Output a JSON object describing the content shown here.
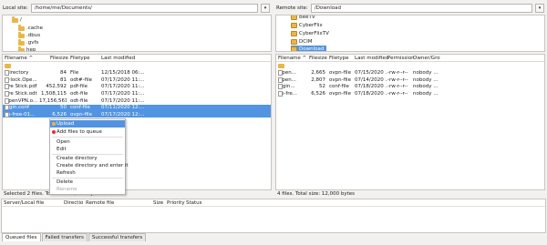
{
  "local": {
    "site_label": "Local site:",
    "path": "/home/me/Documents/",
    "tree": [
      ".cache",
      ".dbus",
      ".gvfs",
      "hep"
    ],
    "tree_root": "/",
    "columns": [
      "Filename ^",
      "Filesize",
      "Filetype",
      "Last modified"
    ],
    "files": [
      {
        "name": "..",
        "size": "",
        "type": "",
        "modified": "",
        "selected": false
      },
      {
        "name": ".directory",
        "size": "84",
        "type": "File",
        "modified": "12/15/2018 06:...",
        "selected": false
      },
      {
        "name": ".~lock.Ope...",
        "size": "81",
        "type": "odt#-file",
        "modified": "07/17/2020 11:...",
        "selected": false
      },
      {
        "name": "Fire Stick.pdf",
        "size": "452,592",
        "type": "pdf-file",
        "modified": "07/17/2020 11:...",
        "selected": false
      },
      {
        "name": "Fire Stick.odt",
        "size": "1,508,115",
        "type": "odt-file",
        "modified": "07/17/2020 11:...",
        "selected": false
      },
      {
        "name": "OpenVPN.o...",
        "size": "17,156,561",
        "type": "odt-file",
        "modified": "07/17/2020 11:...",
        "selected": false
      },
      {
        "name": "login.conf",
        "size": "50",
        "type": "conf-file",
        "modified": "07/11/2020 12:...",
        "selected": true
      },
      {
        "name": "us-free-01...",
        "size": "6,526",
        "type": "ovpn-file",
        "modified": "07/17/2020 12:...",
        "selected": true
      }
    ],
    "status": "Selected 2 files. Total size: 6,576 bytes"
  },
  "remote": {
    "site_label": "Remote site:",
    "path": "/Download",
    "tree": [
      "BeeTV",
      "CyberFlix",
      "CyberFlixTV",
      "DCIM",
      "Download"
    ],
    "columns": [
      "Filename ^",
      "Filesize",
      "Filetype",
      "Last modified",
      "Permission",
      "Owner/Gro"
    ],
    "files": [
      {
        "name": "..",
        "size": "",
        "type": "",
        "modified": "",
        "perm": "",
        "owner": ""
      },
      {
        "name": "Open...",
        "size": "2,665",
        "type": "ovpn-file",
        "modified": "07/15/2020 ...",
        "perm": "-rw-r--r--",
        "owner": "nobody ..."
      },
      {
        "name": "Open...",
        "size": "2,807",
        "type": "ovpn-file",
        "modified": "07/14/2020 ...",
        "perm": "-rw-r--r--",
        "owner": "nobody ..."
      },
      {
        "name": "login...",
        "size": "52",
        "type": "conf-file",
        "modified": "07/18/2020 ...",
        "perm": "-rw-r--r--",
        "owner": "nobody ..."
      },
      {
        "name": "us-fre...",
        "size": "6,526",
        "type": "ovpn-file",
        "modified": "07/18/2020 ...",
        "perm": "-rw-r--r--",
        "owner": "nobody ..."
      }
    ],
    "status": "4 files. Total size: 12,000 bytes"
  },
  "context_menu": {
    "upload": "Upload",
    "add_to_queue": "Add files to queue",
    "open": "Open",
    "edit": "Edit",
    "create_dir": "Create directory",
    "create_dir_enter": "Create directory and enter it",
    "refresh": "Refresh",
    "delete": "Delete",
    "rename": "Rename"
  },
  "queue": {
    "columns": [
      "Server/Local file",
      "Directio",
      "Remote file",
      "Size",
      "Priority",
      "Status"
    ],
    "tabs": [
      "Queued files",
      "Failed transfers",
      "Successful transfers"
    ]
  },
  "colors": {
    "selection": "#5294e2",
    "folder": "#e9b64a"
  }
}
